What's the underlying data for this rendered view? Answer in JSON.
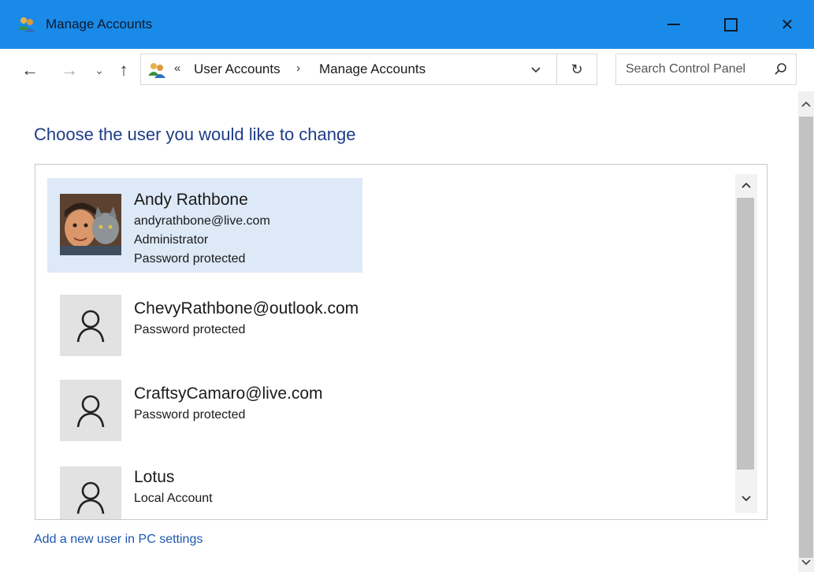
{
  "window": {
    "title": "Manage Accounts",
    "titlebar_color": "#1a8ae8",
    "icon": "users-icon",
    "controls": [
      "minimize-icon",
      "maximize-icon",
      "close-icon"
    ],
    "close_glyph": "✕"
  },
  "nav": {
    "back_glyph": "←",
    "forward_glyph": "→",
    "recent_glyph": "⌄",
    "up_glyph": "↑",
    "overflow": "«",
    "separator": "›",
    "breadcrumbs": [
      "User Accounts",
      "Manage Accounts"
    ],
    "dropdown_glyph": "⌄",
    "refresh_glyph": "↻",
    "search_placeholder": "Search Control Panel"
  },
  "main": {
    "heading": "Choose the user you would like to change",
    "heading_color": "#1e3d87",
    "accounts": [
      {
        "name": "Andy Rathbone",
        "details": [
          "andyrathbone@live.com",
          "Administrator",
          "Password protected"
        ],
        "avatar": "user-photo",
        "selected": true
      },
      {
        "name": "ChevyRathbone@outlook.com",
        "details": [
          "Password protected"
        ],
        "avatar": "person-icon",
        "selected": false
      },
      {
        "name": "CraftsyCamaro@live.com",
        "details": [
          "Password protected"
        ],
        "avatar": "person-icon",
        "selected": false
      },
      {
        "name": "Lotus",
        "details": [
          "Local Account"
        ],
        "avatar": "person-icon",
        "selected": false
      }
    ],
    "add_user_link": "Add a new user in PC settings",
    "link_color": "#1d56b0",
    "selection_color": "#dde9f7"
  }
}
